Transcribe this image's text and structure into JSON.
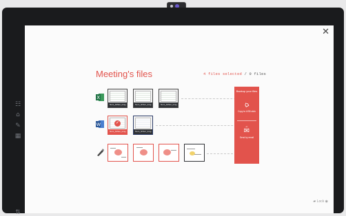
{
  "dialog": {
    "title": "Meeting's files",
    "selection_count": "4 files selected",
    "selection_total": "/ 9 files"
  },
  "rows": {
    "excel": {
      "app_icon": "excel-icon",
      "files": [
        {
          "name": "Nom_fichier_long...",
          "selected": true
        },
        {
          "name": "Nom_fichier_long...",
          "selected": false
        },
        {
          "name": "Nom_fichier_long...",
          "selected": false
        }
      ]
    },
    "word": {
      "app_icon": "word-icon",
      "files": [
        {
          "name": "Nom_fichier_long...",
          "selected": true
        },
        {
          "name": "Nom_fichier_long...",
          "selected": false
        }
      ]
    },
    "drawings": {
      "app_icon": "pen-icon",
      "count": 4
    }
  },
  "backup_panel": {
    "title": "Backup your files",
    "usb_label": "Copy to USB stick",
    "or": "or",
    "email_label": "Send by email"
  },
  "footer": {
    "label": "Lock"
  },
  "colors": {
    "accent": "#e2534c",
    "bezel": "#1a1b1d"
  }
}
